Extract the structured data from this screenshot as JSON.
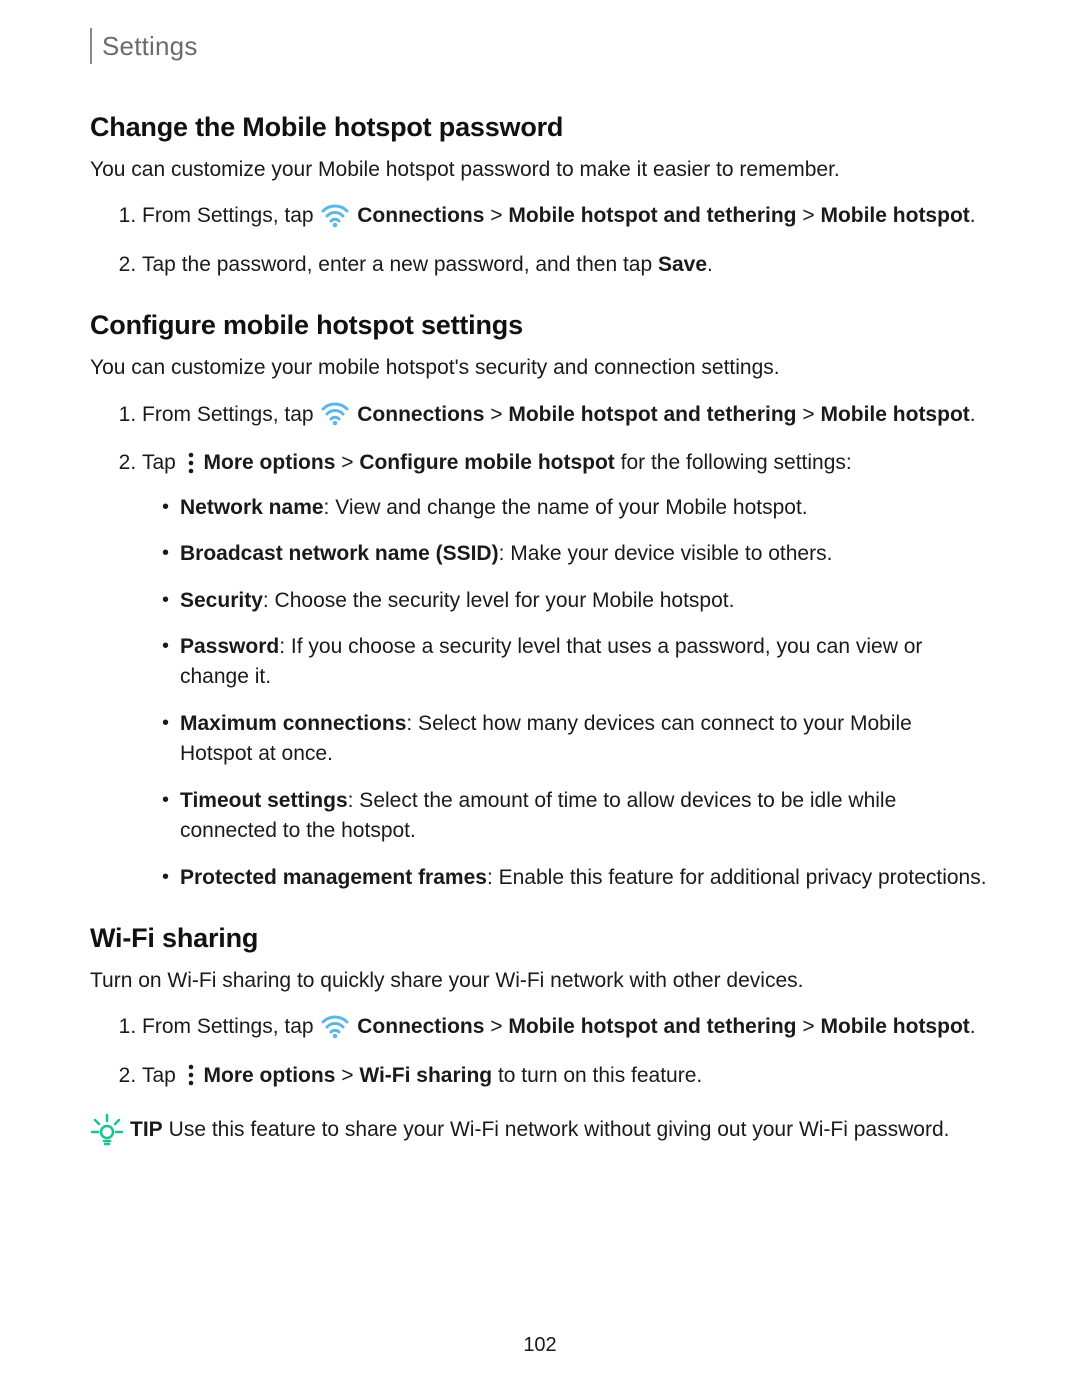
{
  "header": {
    "title": "Settings"
  },
  "sections": {
    "s1": {
      "heading": "Change the Mobile hotspot password",
      "intro": "You can customize your Mobile hotspot password to make it easier to remember.",
      "step1_pre": "From Settings, tap ",
      "step1_bold1": "Connections",
      "step1_sep1": " > ",
      "step1_bold2": "Mobile hotspot and tethering",
      "step1_sep2": " > ",
      "step1_bold3": "Mobile hotspot",
      "step1_post": ".",
      "step2_pre": "Tap the password, enter a new password, and then tap ",
      "step2_bold": "Save",
      "step2_post": "."
    },
    "s2": {
      "heading": "Configure mobile hotspot settings",
      "intro": "You can customize your mobile hotspot's security and connection settings.",
      "step1_pre": "From Settings, tap ",
      "step1_bold1": "Connections",
      "step1_sep1": " > ",
      "step1_bold2": "Mobile hotspot and tethering",
      "step1_sep2": " > ",
      "step1_bold3": "Mobile hotspot",
      "step1_post": ".",
      "step2_pre": "Tap ",
      "step2_bold1": "More options",
      "step2_sep1": " > ",
      "step2_bold2": "Configure mobile hotspot",
      "step2_post": " for the following settings:",
      "bullets": {
        "b1_bold": "Network name",
        "b1_rest": ": View and change the name of your Mobile hotspot.",
        "b2_bold": "Broadcast network name (SSID)",
        "b2_rest": ": Make your device visible to others.",
        "b3_bold": "Security",
        "b3_rest": ": Choose the security level for your Mobile hotspot.",
        "b4_bold": "Password",
        "b4_rest": ": If you choose a security level that uses a password, you can view or change it.",
        "b5_bold": "Maximum connections",
        "b5_rest": ": Select how many devices can connect to your Mobile Hotspot at once.",
        "b6_bold": "Timeout settings",
        "b6_rest": ": Select the amount of time to allow devices to be idle while connected to the hotspot.",
        "b7_bold": "Protected management frames",
        "b7_rest": ": Enable this feature for additional privacy protections."
      }
    },
    "s3": {
      "heading": "Wi-Fi sharing",
      "intro": "Turn on Wi-Fi sharing to quickly share your Wi-Fi network with other devices.",
      "step1_pre": "From Settings, tap ",
      "step1_bold1": "Connections",
      "step1_sep1": " > ",
      "step1_bold2": "Mobile hotspot and tethering",
      "step1_sep2": " > ",
      "step1_bold3": "Mobile hotspot",
      "step1_post": ".",
      "step2_pre": "Tap ",
      "step2_bold1": "More options",
      "step2_sep1": " > ",
      "step2_bold2": "Wi-Fi sharing",
      "step2_post": " to turn on this feature."
    }
  },
  "tip": {
    "label": "TIP",
    "body": "Use this feature to share your Wi-Fi network without giving out your Wi-Fi password."
  },
  "page_number": "102",
  "colors": {
    "accent": "#5ab7e6",
    "tip": "#18c490"
  }
}
